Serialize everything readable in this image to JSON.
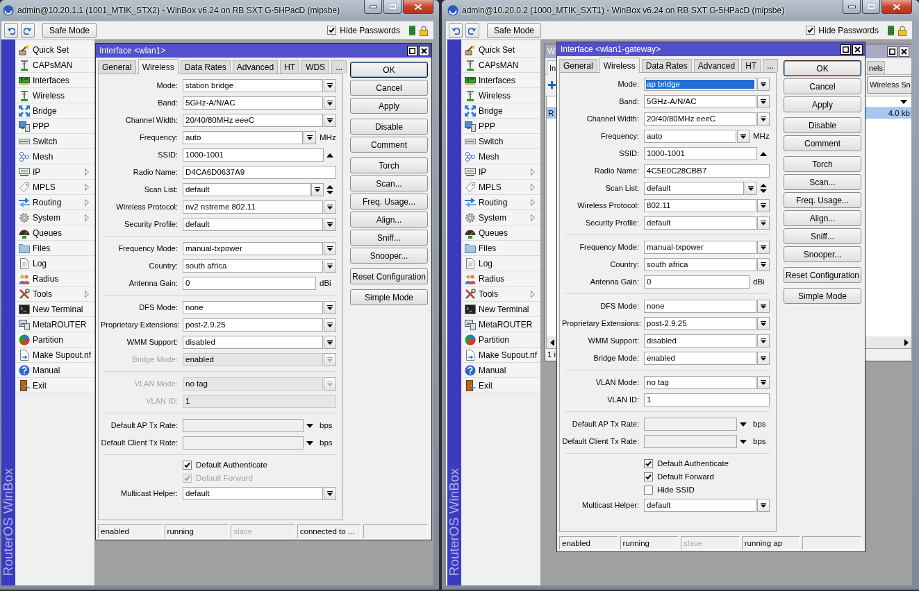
{
  "windows": [
    {
      "title": "admin@10.20.1.1 (1001_MTIK_STX2) - WinBox v6.24 on RB SXT G-5HPacD (mipsbe)",
      "toolbar": {
        "safe_mode": "Safe Mode",
        "hide_passwords": {
          "label": "Hide Passwords",
          "checked": true
        }
      },
      "sidebar": {
        "brand": "RouterOS WinBox",
        "items": [
          {
            "label": "Quick Set",
            "submenu": false
          },
          {
            "label": "CAPsMAN",
            "submenu": false
          },
          {
            "label": "Interfaces",
            "submenu": false
          },
          {
            "label": "Wireless",
            "submenu": false
          },
          {
            "label": "Bridge",
            "submenu": false
          },
          {
            "label": "PPP",
            "submenu": false
          },
          {
            "label": "Switch",
            "submenu": false
          },
          {
            "label": "Mesh",
            "submenu": false
          },
          {
            "label": "IP",
            "submenu": true
          },
          {
            "label": "MPLS",
            "submenu": true
          },
          {
            "label": "Routing",
            "submenu": true
          },
          {
            "label": "System",
            "submenu": true
          },
          {
            "label": "Queues",
            "submenu": false
          },
          {
            "label": "Files",
            "submenu": false
          },
          {
            "label": "Log",
            "submenu": false
          },
          {
            "label": "Radius",
            "submenu": false
          },
          {
            "label": "Tools",
            "submenu": true
          },
          {
            "label": "New Terminal",
            "submenu": false
          },
          {
            "label": "MetaROUTER",
            "submenu": false
          },
          {
            "label": "Partition",
            "submenu": false
          },
          {
            "label": "Make Supout.rif",
            "submenu": false
          },
          {
            "label": "Manual",
            "submenu": false
          },
          {
            "label": "Exit",
            "submenu": false
          }
        ]
      },
      "dialog": {
        "title": "Interface <wlan1>",
        "tabs": [
          {
            "label": "General",
            "selected": false
          },
          {
            "label": "Wireless",
            "selected": true
          },
          {
            "label": "Data Rates",
            "selected": false
          },
          {
            "label": "Advanced",
            "selected": false
          },
          {
            "label": "HT",
            "selected": false
          },
          {
            "label": "WDS",
            "selected": false
          },
          {
            "label": "...",
            "selected": false
          }
        ],
        "sections": [
          {
            "fields": [
              {
                "kind": "select",
                "label": "Mode:",
                "value": "station bridge",
                "disabled": false,
                "focused": false
              },
              {
                "kind": "select",
                "label": "Band:",
                "value": "5GHz-A/N/AC",
                "disabled": false,
                "focused": false
              },
              {
                "kind": "select",
                "label": "Channel Width:",
                "value": "20/40/80MHz eeeC",
                "disabled": false,
                "focused": false
              },
              {
                "kind": "select",
                "label": "Frequency:",
                "value": "auto",
                "unit": "MHz",
                "disabled": false,
                "focused": false
              },
              {
                "kind": "ssid",
                "label": "SSID:",
                "value": "1000-1001",
                "disabled": false,
                "focused": false
              },
              {
                "kind": "input",
                "label": "Radio Name:",
                "value": "D4CA6D0637A9",
                "disabled": false,
                "focused": false
              },
              {
                "kind": "scan",
                "label": "Scan List:",
                "value": "default",
                "disabled": false,
                "focused": false
              },
              {
                "kind": "select",
                "label": "Wireless Protocol:",
                "value": "nv2 nstreme 802.11",
                "disabled": false,
                "focused": false
              },
              {
                "kind": "select",
                "label": "Security Profile:",
                "value": "default",
                "disabled": false,
                "focused": false
              }
            ]
          },
          {
            "fields": [
              {
                "kind": "select",
                "label": "Frequency Mode:",
                "value": "manual-txpower",
                "disabled": false,
                "focused": false
              },
              {
                "kind": "select",
                "label": "Country:",
                "value": "south africa",
                "disabled": false,
                "focused": false
              },
              {
                "kind": "input",
                "label": "Antenna Gain:",
                "value": "0",
                "unit": "dBi",
                "disabled": false,
                "focused": false
              }
            ]
          },
          {
            "fields": [
              {
                "kind": "select",
                "label": "DFS Mode:",
                "value": "none",
                "disabled": false,
                "focused": false
              },
              {
                "kind": "select",
                "label": "Proprietary Extensions:",
                "value": "post-2.9.25",
                "disabled": false,
                "focused": false
              },
              {
                "kind": "select",
                "label": "WMM Support:",
                "value": "disabled",
                "disabled": false,
                "focused": false
              },
              {
                "kind": "select",
                "label": "Bridge Mode:",
                "value": "enabled",
                "disabled": true,
                "focused": false
              }
            ]
          },
          {
            "fields": [
              {
                "kind": "select",
                "label": "VLAN Mode:",
                "value": "no tag",
                "disabled": true,
                "focused": false
              },
              {
                "kind": "input",
                "label": "VLAN ID:",
                "value": "1",
                "disabled": true,
                "focused": false
              }
            ]
          },
          {
            "fields": [
              {
                "kind": "rate",
                "label": "Default AP Tx Rate:",
                "unit": "bps",
                "disabled": false,
                "focused": false
              },
              {
                "kind": "rate",
                "label": "Default Client Tx Rate:",
                "unit": "bps",
                "disabled": false,
                "focused": false
              }
            ]
          },
          {
            "fields": [
              {
                "kind": "checkbox",
                "label": "Default Authenticate",
                "checked": true,
                "disabled": false,
                "focused": false
              },
              {
                "kind": "checkbox",
                "label": "Default Forward",
                "checked": true,
                "disabled": true,
                "focused": false
              },
              {
                "kind": "select",
                "label": "Multicast Helper:",
                "value": "default",
                "disabled": false,
                "focused": false
              }
            ]
          }
        ],
        "button_groups": [
          [
            {
              "label": "OK",
              "default": true
            },
            {
              "label": "Cancel",
              "default": false
            },
            {
              "label": "Apply",
              "default": false
            }
          ],
          [
            {
              "label": "Disable",
              "default": false
            },
            {
              "label": "Comment",
              "default": false
            }
          ],
          [
            {
              "label": "Torch",
              "default": false
            },
            {
              "label": "Scan...",
              "default": false
            },
            {
              "label": "Freq. Usage...",
              "default": false
            },
            {
              "label": "Align...",
              "default": false
            },
            {
              "label": "Sniff...",
              "default": false
            },
            {
              "label": "Snooper...",
              "default": false
            }
          ],
          [
            {
              "label": "Reset Configuration",
              "default": false
            }
          ],
          [
            {
              "label": "Simple Mode",
              "default": false
            }
          ]
        ],
        "status_bar": [
          {
            "text": "enabled",
            "disabled": false
          },
          {
            "text": "running",
            "disabled": false
          },
          {
            "text": "slave",
            "disabled": true
          },
          {
            "text": "connected to ...",
            "disabled": false
          }
        ]
      }
    },
    {
      "title": "admin@10.20.0.2 (1000_MTIK_SXT1) - WinBox v6.24 on RB SXT G-5HPacD (mipsbe)",
      "toolbar": {
        "safe_mode": "Safe Mode",
        "hide_passwords": {
          "label": "Hide Passwords",
          "checked": true
        }
      },
      "sidebar": {
        "brand": "RouterOS WinBox",
        "items": [
          {
            "label": "Quick Set",
            "submenu": false
          },
          {
            "label": "CAPsMAN",
            "submenu": false
          },
          {
            "label": "Interfaces",
            "submenu": false
          },
          {
            "label": "Wireless",
            "submenu": false
          },
          {
            "label": "Bridge",
            "submenu": false
          },
          {
            "label": "PPP",
            "submenu": false
          },
          {
            "label": "Switch",
            "submenu": false
          },
          {
            "label": "Mesh",
            "submenu": false
          },
          {
            "label": "IP",
            "submenu": true
          },
          {
            "label": "MPLS",
            "submenu": true
          },
          {
            "label": "Routing",
            "submenu": true
          },
          {
            "label": "System",
            "submenu": true
          },
          {
            "label": "Queues",
            "submenu": false
          },
          {
            "label": "Files",
            "submenu": false
          },
          {
            "label": "Log",
            "submenu": false
          },
          {
            "label": "Radius",
            "submenu": false
          },
          {
            "label": "Tools",
            "submenu": true
          },
          {
            "label": "New Terminal",
            "submenu": false
          },
          {
            "label": "MetaROUTER",
            "submenu": false
          },
          {
            "label": "Partition",
            "submenu": false
          },
          {
            "label": "Make Supout.rif",
            "submenu": false
          },
          {
            "label": "Manual",
            "submenu": false
          },
          {
            "label": "Exit",
            "submenu": false
          }
        ]
      },
      "background_window": {
        "title": "W",
        "tabs": [
          {
            "label": "In",
            "selected": true
          },
          {
            "label": "nels",
            "selected": false
          }
        ],
        "button": "Wireless Sn",
        "rows": [
          {
            "first_cell": "R",
            "last_cell": "4.0 kb",
            "selected": true
          }
        ],
        "status": "1 i"
      },
      "dialog": {
        "title": "Interface <wlan1-gateway>",
        "tabs": [
          {
            "label": "General",
            "selected": false
          },
          {
            "label": "Wireless",
            "selected": true
          },
          {
            "label": "Data Rates",
            "selected": false
          },
          {
            "label": "Advanced",
            "selected": false
          },
          {
            "label": "HT",
            "selected": false
          },
          {
            "label": "...",
            "selected": false
          }
        ],
        "sections": [
          {
            "fields": [
              {
                "kind": "select",
                "label": "Mode:",
                "value": "ap bridge",
                "disabled": false,
                "focused": true
              },
              {
                "kind": "select",
                "label": "Band:",
                "value": "5GHz-A/N/AC",
                "disabled": false,
                "focused": false
              },
              {
                "kind": "select",
                "label": "Channel Width:",
                "value": "20/40/80MHz eeeC",
                "disabled": false,
                "focused": false
              },
              {
                "kind": "select",
                "label": "Frequency:",
                "value": "auto",
                "unit": "MHz",
                "disabled": false,
                "focused": false
              },
              {
                "kind": "ssid",
                "label": "SSID:",
                "value": "1000-1001",
                "disabled": false,
                "focused": false
              },
              {
                "kind": "input",
                "label": "Radio Name:",
                "value": "4C5E0C28CBB7",
                "disabled": false,
                "focused": false
              },
              {
                "kind": "scan",
                "label": "Scan List:",
                "value": "default",
                "disabled": false,
                "focused": false
              },
              {
                "kind": "select",
                "label": "Wireless Protocol:",
                "value": "802.11",
                "disabled": false,
                "focused": false
              },
              {
                "kind": "select",
                "label": "Security Profile:",
                "value": "default",
                "disabled": false,
                "focused": false
              }
            ]
          },
          {
            "fields": [
              {
                "kind": "select",
                "label": "Frequency Mode:",
                "value": "manual-txpower",
                "disabled": false,
                "focused": false
              },
              {
                "kind": "select",
                "label": "Country:",
                "value": "south africa",
                "disabled": false,
                "focused": false
              },
              {
                "kind": "input",
                "label": "Antenna Gain:",
                "value": "0",
                "unit": "dBi",
                "disabled": false,
                "focused": false
              }
            ]
          },
          {
            "fields": [
              {
                "kind": "select",
                "label": "DFS Mode:",
                "value": "none",
                "disabled": false,
                "focused": false
              },
              {
                "kind": "select",
                "label": "Proprietary Extensions:",
                "value": "post-2.9.25",
                "disabled": false,
                "focused": false
              },
              {
                "kind": "select",
                "label": "WMM Support:",
                "value": "disabled",
                "disabled": false,
                "focused": false
              },
              {
                "kind": "select",
                "label": "Bridge Mode:",
                "value": "enabled",
                "disabled": false,
                "focused": false
              }
            ]
          },
          {
            "fields": [
              {
                "kind": "select",
                "label": "VLAN Mode:",
                "value": "no tag",
                "disabled": false,
                "focused": false
              },
              {
                "kind": "input",
                "label": "VLAN ID:",
                "value": "1",
                "disabled": false,
                "focused": false
              }
            ]
          },
          {
            "fields": [
              {
                "kind": "rate",
                "label": "Default AP Tx Rate:",
                "unit": "bps",
                "disabled": false,
                "focused": false
              },
              {
                "kind": "rate",
                "label": "Default Client Tx Rate:",
                "unit": "bps",
                "disabled": false,
                "focused": false
              }
            ]
          },
          {
            "fields": [
              {
                "kind": "checkbox",
                "label": "Default Authenticate",
                "checked": true,
                "disabled": false,
                "focused": false
              },
              {
                "kind": "checkbox",
                "label": "Default Forward",
                "checked": true,
                "disabled": false,
                "focused": false
              },
              {
                "kind": "checkbox",
                "label": "Hide SSID",
                "checked": false,
                "disabled": false,
                "focused": false
              },
              {
                "kind": "select",
                "label": "Multicast Helper:",
                "value": "default",
                "disabled": false,
                "focused": false
              }
            ]
          }
        ],
        "button_groups": [
          [
            {
              "label": "OK",
              "default": true
            },
            {
              "label": "Cancel",
              "default": false
            },
            {
              "label": "Apply",
              "default": false
            }
          ],
          [
            {
              "label": "Disable",
              "default": false
            },
            {
              "label": "Comment",
              "default": false
            }
          ],
          [
            {
              "label": "Torch",
              "default": false
            },
            {
              "label": "Scan...",
              "default": false
            },
            {
              "label": "Freq. Usage...",
              "default": false
            },
            {
              "label": "Align...",
              "default": false
            },
            {
              "label": "Sniff...",
              "default": false
            },
            {
              "label": "Snooper...",
              "default": false
            }
          ],
          [
            {
              "label": "Reset Configuration",
              "default": false
            }
          ],
          [
            {
              "label": "Simple Mode",
              "default": false
            }
          ]
        ],
        "status_bar": [
          {
            "text": "enabled",
            "disabled": false
          },
          {
            "text": "running",
            "disabled": false
          },
          {
            "text": "slave",
            "disabled": true
          },
          {
            "text": "running ap",
            "disabled": false
          }
        ]
      }
    }
  ]
}
